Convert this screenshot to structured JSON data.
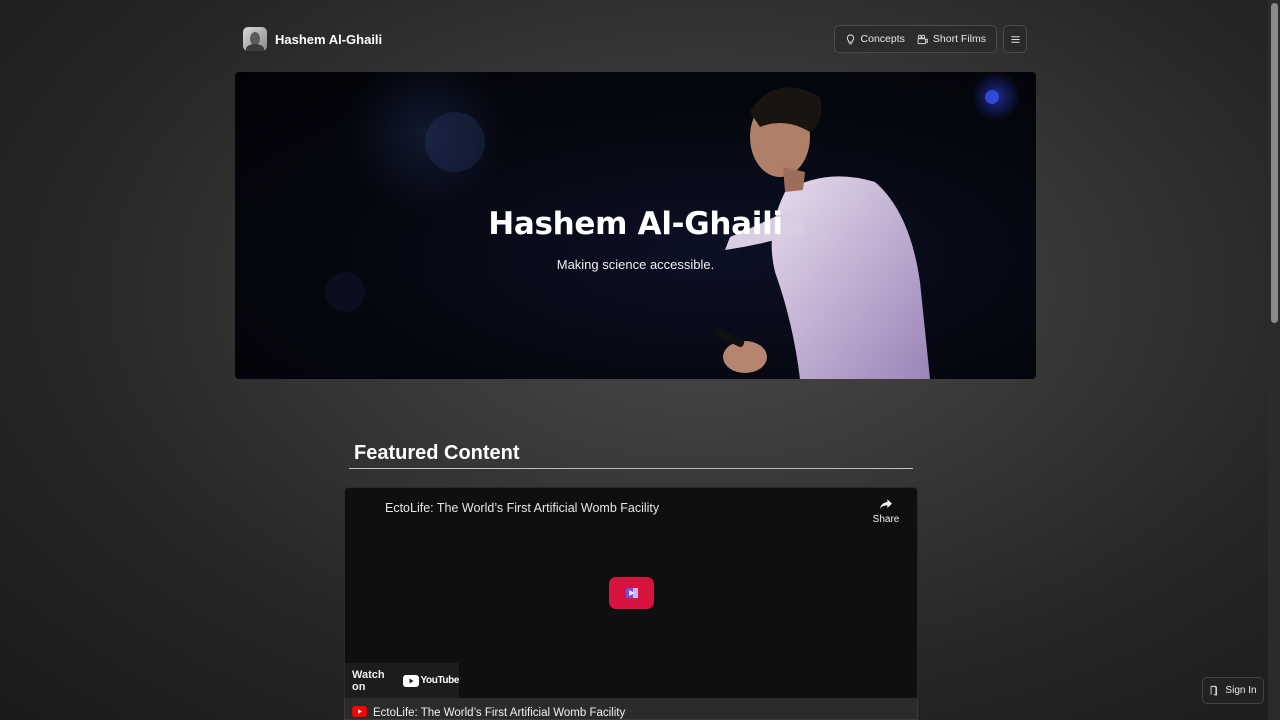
{
  "header": {
    "brand_name": "Hashem Al-Ghaili",
    "nav": [
      {
        "label": "Concepts",
        "icon": "lightbulb-icon"
      },
      {
        "label": "Short Films",
        "icon": "film-icon"
      }
    ],
    "menu_icon": "hamburger-menu-icon"
  },
  "hero": {
    "title": "Hashem Al-Ghaili",
    "subtitle": "Making science accessible."
  },
  "featured": {
    "heading": "Featured Content",
    "video": {
      "title": "EctoLife: The World’s First Artificial Womb Facility",
      "share_label": "Share",
      "watch_on_label": "Watch on",
      "platform": "YouTube",
      "caption": "EctoLife: The World’s First Artificial Womb Facility"
    }
  },
  "signin": {
    "label": "Sign In",
    "icon": "sign-in-icon"
  },
  "colors": {
    "accent_red": "#d6133f",
    "background": "#2f2f2f"
  }
}
